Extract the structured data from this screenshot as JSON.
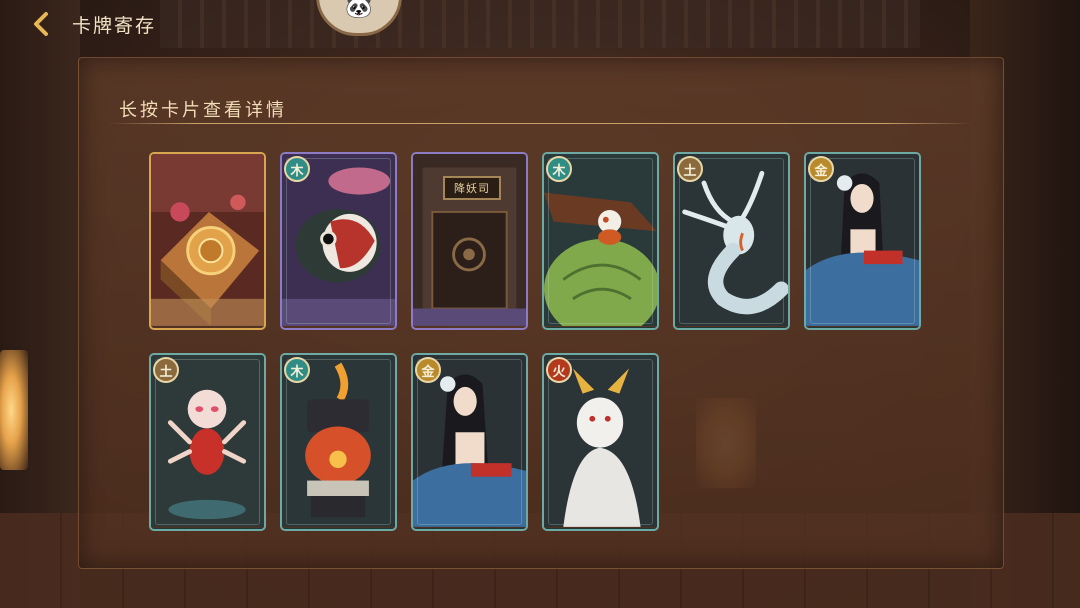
{
  "header": {
    "title": "卡牌寄存",
    "back_icon": "chevron-left-icon"
  },
  "panel": {
    "instruction": "长按卡片查看详情"
  },
  "cards": [
    {
      "element": "",
      "frame": "gold",
      "art": "spirit-compass-scene"
    },
    {
      "element": "木",
      "frame": "purple",
      "art": "koi-fish-demon"
    },
    {
      "element": "",
      "frame": "purple",
      "art": "temple-gate",
      "plaque": "降妖司"
    },
    {
      "element": "木",
      "frame": "teal",
      "art": "fox-on-turtle-shell"
    },
    {
      "element": "土",
      "frame": "teal",
      "art": "white-serpent-spirit"
    },
    {
      "element": "金",
      "frame": "teal",
      "art": "robed-lady"
    },
    {
      "element": "土",
      "frame": "teal",
      "art": "multi-armed-child"
    },
    {
      "element": "木",
      "frame": "teal",
      "art": "lantern-creature"
    },
    {
      "element": "金",
      "frame": "teal",
      "art": "robed-lady"
    },
    {
      "element": "火",
      "frame": "teal",
      "art": "white-fox-spirit"
    }
  ],
  "colors": {
    "frame_teal": "#6fa9a3",
    "frame_gold": "#d8a550",
    "frame_purple": "#8d7bc4",
    "text_light": "#f0dcb6"
  }
}
